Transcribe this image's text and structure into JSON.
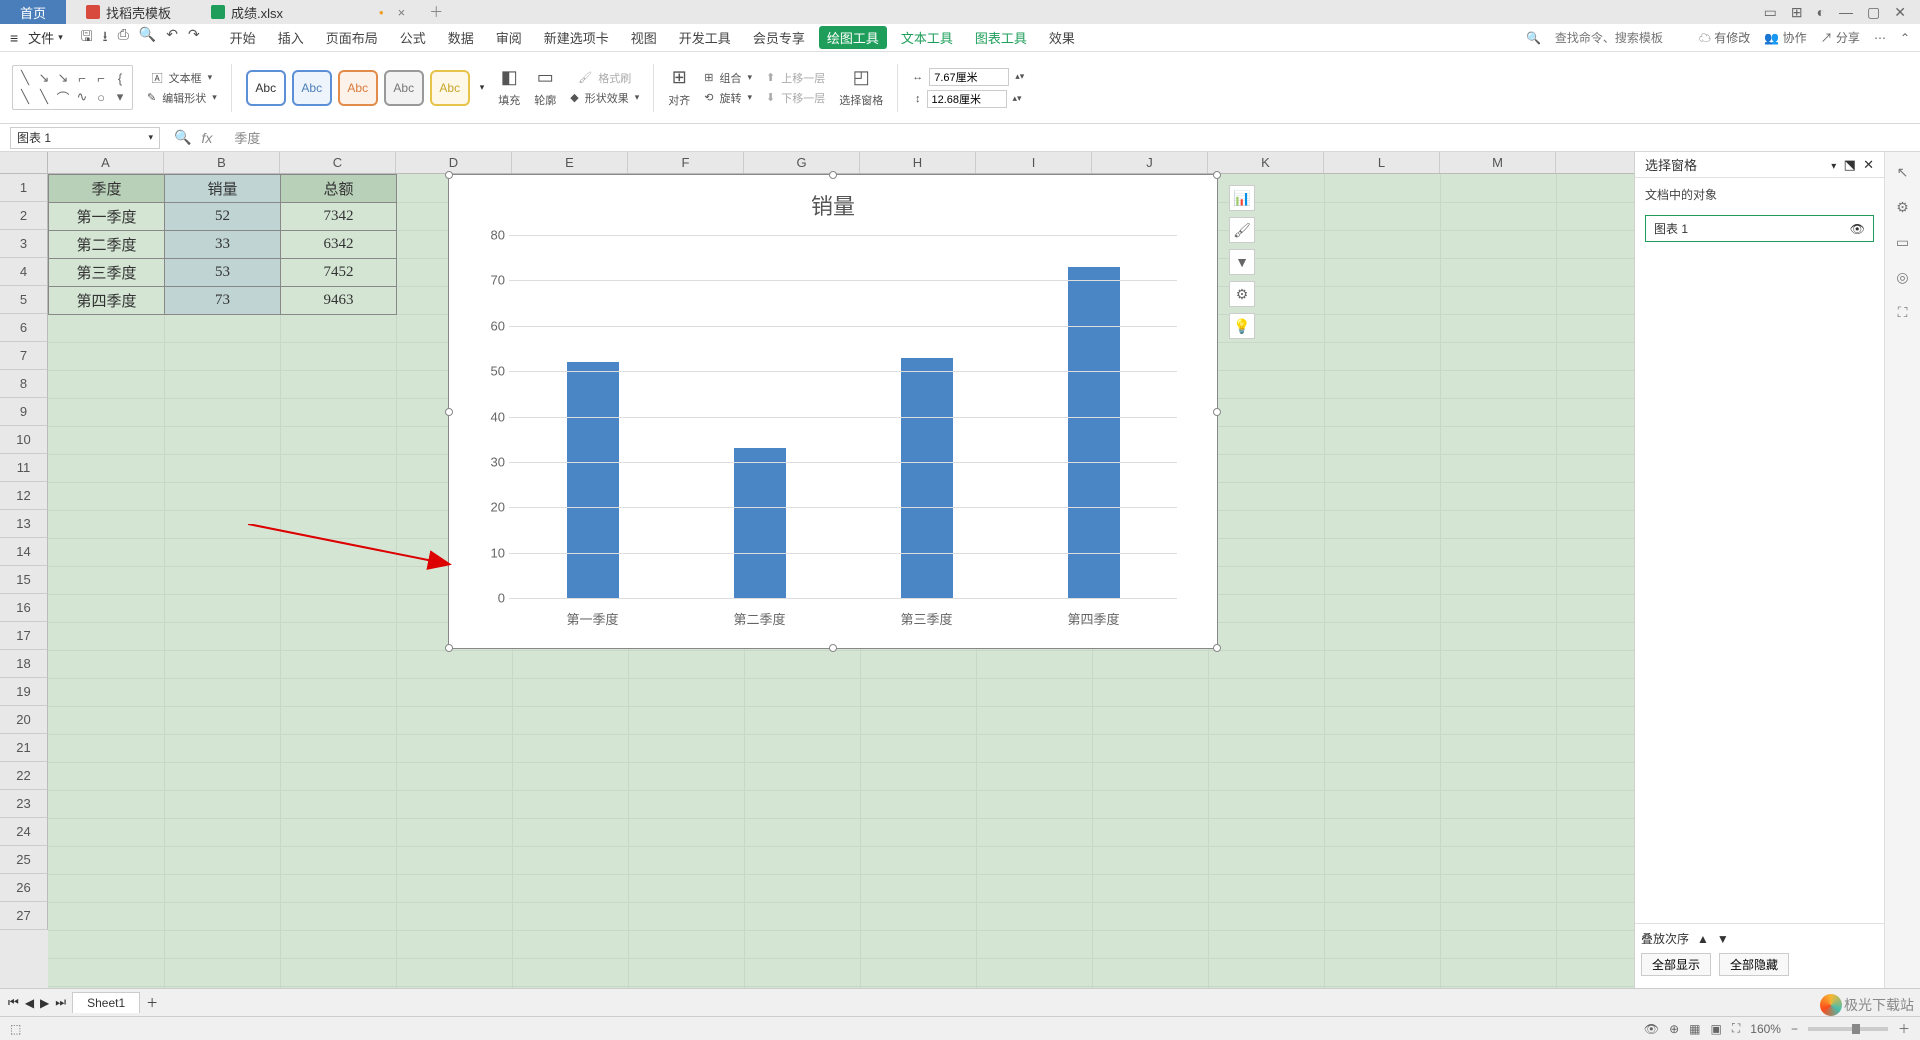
{
  "titlebar": {
    "tabs": [
      {
        "label": "首页",
        "active": true
      },
      {
        "label": "找稻壳模板",
        "icon": "#d84a3d"
      },
      {
        "label": "成绩.xlsx",
        "icon": "#1e9e5a",
        "modified": "•"
      }
    ]
  },
  "menubar": {
    "file": "文件",
    "tabs": [
      "开始",
      "插入",
      "页面布局",
      "公式",
      "数据",
      "审阅",
      "新建选项卡",
      "视图",
      "开发工具",
      "会员专享"
    ],
    "ctx": [
      "绘图工具",
      "文本工具",
      "图表工具",
      "效果"
    ],
    "search_placeholder": "查找命令、搜索模板",
    "right": {
      "pending": "有修改",
      "coop": "协作",
      "share": "分享"
    }
  },
  "ribbon": {
    "textbox": "文本框",
    "editshape": "编辑形状",
    "abc": "Abc",
    "fill": "填充",
    "outline": "轮廓",
    "effect": "形状效果",
    "formatpaint": "格式刷",
    "align": "对齐",
    "group": "组合",
    "rotate": "旋转",
    "forward": "上移一层",
    "backward": "下移一层",
    "selpane": "选择窗格",
    "width_label": "",
    "width": "7.67厘米",
    "height": "12.68厘米"
  },
  "fbar": {
    "name": "图表 1",
    "formula": "季度"
  },
  "columns": [
    "A",
    "B",
    "C",
    "D",
    "E",
    "F",
    "G",
    "H",
    "I",
    "J",
    "K",
    "L",
    "M"
  ],
  "rows": 27,
  "table": {
    "headers": [
      "季度",
      "销量",
      "总额"
    ],
    "data": [
      [
        "第一季度",
        "52",
        "7342"
      ],
      [
        "第二季度",
        "33",
        "6342"
      ],
      [
        "第三季度",
        "53",
        "7452"
      ],
      [
        "第四季度",
        "73",
        "9463"
      ]
    ]
  },
  "chart_data": {
    "type": "bar",
    "title": "销量",
    "categories": [
      "第一季度",
      "第二季度",
      "第三季度",
      "第四季度"
    ],
    "values": [
      52,
      33,
      53,
      73
    ],
    "ylim": [
      0,
      80
    ],
    "ystep": 10,
    "xlabel": "",
    "ylabel": ""
  },
  "rpane": {
    "title": "选择窗格",
    "subtitle": "文档中的对象",
    "item": "图表 1",
    "order": "叠放次序",
    "showall": "全部显示",
    "hideall": "全部隐藏"
  },
  "sheets": {
    "name": "Sheet1"
  },
  "status": {
    "zoom": "160%",
    "watermark": "极光下载站"
  }
}
